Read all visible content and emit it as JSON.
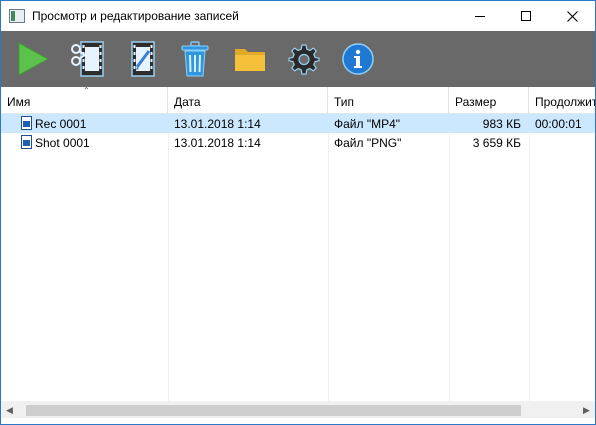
{
  "window": {
    "title": "Просмотр и редактирование записей"
  },
  "toolbar": {
    "buttons": [
      {
        "name": "play",
        "icon": "play-icon",
        "color": "#5dc24b"
      },
      {
        "name": "cut",
        "icon": "film-scissors-icon"
      },
      {
        "name": "edit",
        "icon": "film-edit-icon"
      },
      {
        "name": "delete",
        "icon": "trash-icon",
        "color": "#2f96df"
      },
      {
        "name": "folder",
        "icon": "folder-icon",
        "color": "#f5c13a"
      },
      {
        "name": "settings",
        "icon": "gear-icon"
      },
      {
        "name": "info",
        "icon": "info-icon",
        "color": "#1f78d1"
      }
    ]
  },
  "list": {
    "columns": [
      "Имя",
      "Дата",
      "Тип",
      "Размер",
      "Продолжит"
    ],
    "rows": [
      {
        "name": "Rec 0001",
        "date": "13.01.2018 1:14",
        "type": "Файл \"MP4\"",
        "size": "983 КБ",
        "duration": "00:00:01",
        "selected": true
      },
      {
        "name": "Shot 0001",
        "date": "13.01.2018 1:14",
        "type": "Файл \"PNG\"",
        "size": "3 659 КБ",
        "duration": "",
        "selected": false
      }
    ]
  },
  "colors": {
    "toolbar_bg": "#696969",
    "selection": "#cce8ff",
    "window_border": "#2b78c6"
  }
}
